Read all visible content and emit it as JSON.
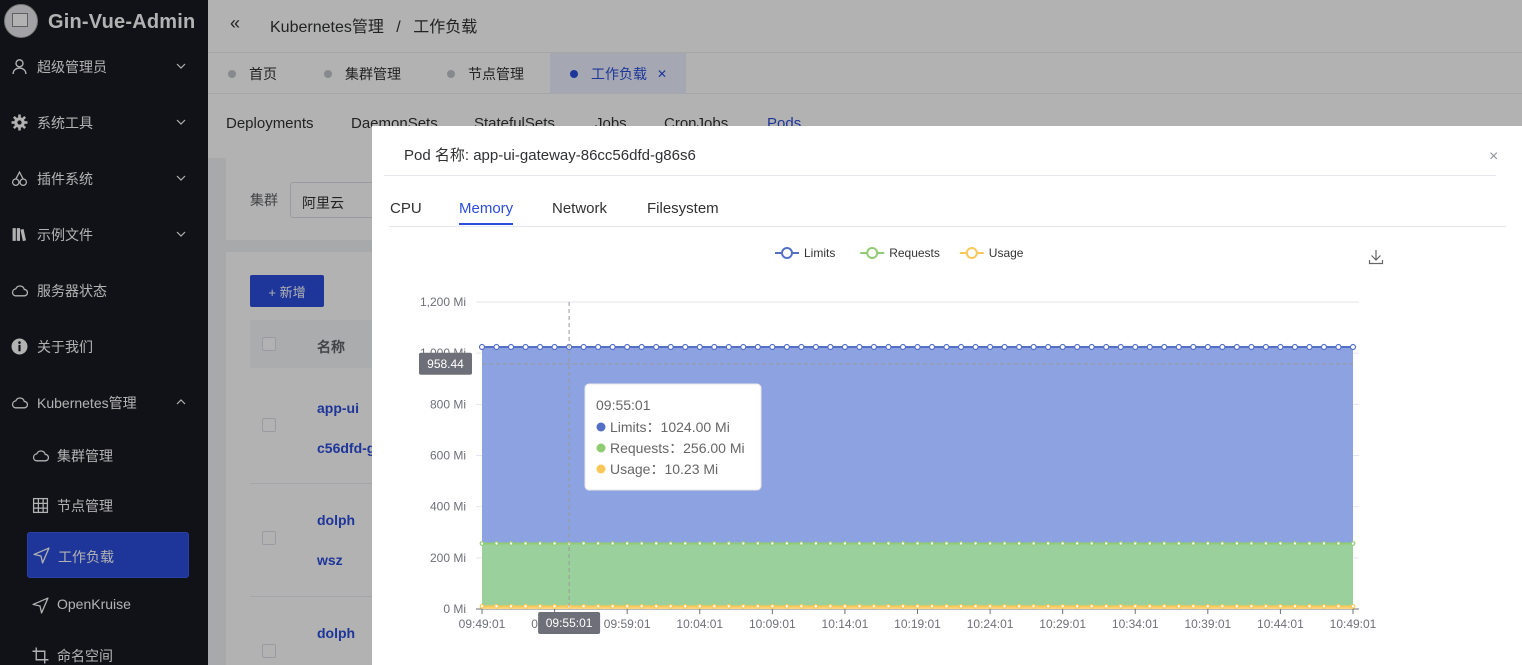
{
  "app": {
    "title": "Gin-Vue-Admin"
  },
  "sidebar": {
    "items": [
      {
        "label": "超级管理员",
        "icon": "user-icon"
      },
      {
        "label": "系统工具",
        "icon": "gear-icon"
      },
      {
        "label": "插件系统",
        "icon": "cherry-icon"
      },
      {
        "label": "示例文件",
        "icon": "book-icon"
      },
      {
        "label": "服务器状态",
        "icon": "cloud-icon"
      },
      {
        "label": "关于我们",
        "icon": "info-icon"
      },
      {
        "label": "Kubernetes管理",
        "icon": "cloud-icon"
      }
    ],
    "subitems": [
      {
        "label": "集群管理",
        "icon": "cloud-icon"
      },
      {
        "label": "节点管理",
        "icon": "grid-icon"
      },
      {
        "label": "工作负载",
        "icon": "navigation-icon"
      },
      {
        "label": "OpenKruise",
        "icon": "navigation-icon"
      },
      {
        "label": "命名空间",
        "icon": "crop-icon"
      }
    ]
  },
  "header": {
    "breadcrumb": [
      "Kubernetes管理",
      "工作负载"
    ],
    "breadcrumb_sep": "/",
    "collapse_glyph": "«"
  },
  "tabs": [
    {
      "label": "首页"
    },
    {
      "label": "集群管理"
    },
    {
      "label": "节点管理"
    },
    {
      "label": "工作负载"
    }
  ],
  "subtabs": [
    "Deployments",
    "DaemonSets",
    "StatefulSets",
    "Jobs",
    "CronJobs",
    "Pods"
  ],
  "filter": {
    "label": "集群",
    "value": "阿里云"
  },
  "toolbar": {
    "add_label": "+ 新增"
  },
  "table": {
    "header_name": "名称",
    "rows": [
      {
        "name_line1": "app-ui",
        "name_line2": "c56dfd-g"
      },
      {
        "name_line1": "dolph",
        "name_line2": "wsz"
      },
      {
        "name_line1": "dolph"
      }
    ]
  },
  "dialog": {
    "title": "Pod 名称: app-ui-gateway-86cc56dfd-g86s6",
    "close_glyph": "×",
    "tabs": [
      "CPU",
      "Memory",
      "Network",
      "Filesystem"
    ],
    "active_tab": "Memory"
  },
  "chart_data": {
    "type": "area",
    "x": [
      "09:49:01",
      "09:50:01",
      "09:51:01",
      "09:52:01",
      "09:53:01",
      "09:54:01",
      "09:55:01",
      "09:56:01",
      "09:57:01",
      "09:58:01",
      "09:59:01",
      "10:00:01",
      "10:01:01",
      "10:02:01",
      "10:03:01",
      "10:04:01",
      "10:05:01",
      "10:06:01",
      "10:07:01",
      "10:08:01",
      "10:09:01",
      "10:10:01",
      "10:11:01",
      "10:12:01",
      "10:13:01",
      "10:14:01",
      "10:15:01",
      "10:16:01",
      "10:17:01",
      "10:18:01",
      "10:19:01",
      "10:20:01",
      "10:21:01",
      "10:22:01",
      "10:23:01",
      "10:24:01",
      "10:25:01",
      "10:26:01",
      "10:27:01",
      "10:28:01",
      "10:29:01",
      "10:30:01",
      "10:31:01",
      "10:32:01",
      "10:33:01",
      "10:34:01",
      "10:35:01",
      "10:36:01",
      "10:37:01",
      "10:38:01",
      "10:39:01",
      "10:40:01",
      "10:41:01",
      "10:42:01",
      "10:43:01",
      "10:44:01",
      "10:45:01",
      "10:46:01",
      "10:47:01",
      "10:48:01",
      "10:49:01"
    ],
    "xtick_labels": [
      "09:49:01",
      "09:54:01",
      "09:59:01",
      "10:04:01",
      "10:09:01",
      "10:14:01",
      "10:19:01",
      "10:24:01",
      "10:29:01",
      "10:34:01",
      "10:39:01",
      "10:44:01",
      "10:49:01"
    ],
    "series": [
      {
        "name": "Limits",
        "value": 1024,
        "color": "#5470c6",
        "fill": "#8da2e0"
      },
      {
        "name": "Requests",
        "value": 256,
        "color": "#91cc75",
        "fill": "#99d09c"
      },
      {
        "name": "Usage",
        "value": 10.23,
        "color": "#fac858",
        "fill": "#fad680"
      }
    ],
    "ylim": [
      0,
      1200
    ],
    "yticks": [
      0,
      200,
      400,
      600,
      800,
      1000,
      1200
    ],
    "yunit": "Mi",
    "legend": "top-center",
    "grid": true,
    "crosshair": {
      "x": "09:55:01",
      "y": 958.44,
      "y_label": "958.44"
    },
    "tooltip": {
      "title": "09:55:01",
      "rows": [
        {
          "name": "Limits",
          "value": "1024.00 Mi"
        },
        {
          "name": "Requests",
          "value": "256.00 Mi"
        },
        {
          "name": "Usage",
          "value": "10.23 Mi"
        }
      ]
    }
  }
}
